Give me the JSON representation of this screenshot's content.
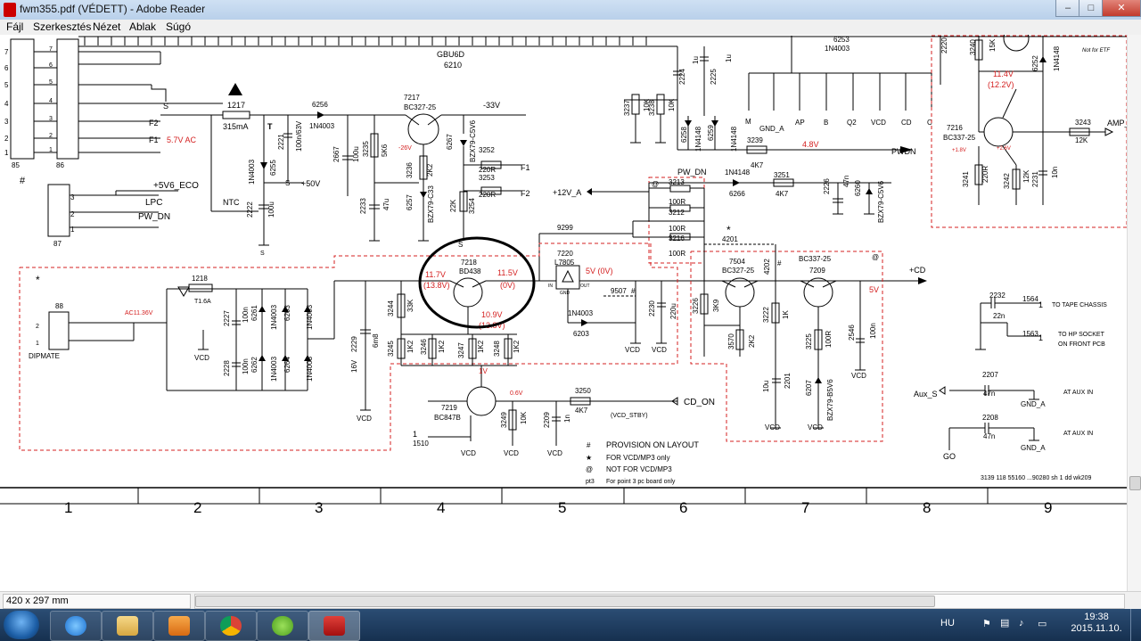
{
  "window": {
    "title": "fwm355.pdf (VÉDETT) - Adobe Reader",
    "buttons": {
      "minimize": "–",
      "maximize": "□",
      "close": "✕"
    }
  },
  "menu": [
    "Fájl",
    "Szerkesztés",
    "Nézet",
    "Ablak",
    "Súgó"
  ],
  "status": {
    "page_size": "420 x 297 mm"
  },
  "taskbar": {
    "apps": [
      "internet-explorer-icon",
      "file-explorer-icon",
      "media-player-icon",
      "chrome-icon",
      "utorrent-icon",
      "adobe-reader-icon"
    ],
    "language": "HU",
    "time": "19:38",
    "date": "2015.11.10."
  },
  "colors": {
    "titlebar": "#bcd2ec",
    "schematic_ink": "#000000",
    "annotation_red": "#d42020",
    "taskbar": "#1f3d62"
  },
  "schematic": {
    "connector_left": {
      "pins": [
        "7",
        "6",
        "5",
        "4",
        "3",
        "2",
        "1"
      ],
      "left_label": "85",
      "right_label": "86"
    },
    "connector_87": {
      "pins": [
        "3",
        "2",
        "1"
      ],
      "label": "87",
      "signals": [
        "LPC",
        "PW_DN"
      ]
    },
    "connector_88": {
      "pins": [
        "2",
        "1"
      ],
      "label": "88",
      "name": "DIPMATE"
    },
    "bus": {
      "name": "GBU6D",
      "ref": "6210"
    },
    "top_left": {
      "f2": "F2",
      "f1": "F1",
      "f1_ac": "5.7V AC",
      "s_mark": "S",
      "plus5v6eco": "+5V6_ECO",
      "hash": "#"
    },
    "fuse": {
      "ref": "1217",
      "value": "315mA",
      "t": "T"
    },
    "ntc": "NTC",
    "c2222": {
      "ref": "2222",
      "value": "100u"
    },
    "d6255": {
      "ref": "6255",
      "part": "1N4003"
    },
    "c2221": {
      "ref": "2221",
      "value": "100n/63V",
      "s": "S",
      "plus50v": "+50V"
    },
    "d6256": {
      "ref": "6256",
      "part": "1N4003"
    },
    "c2667": {
      "ref": "2667",
      "value": "100u"
    },
    "r3235": {
      "ref": "3235",
      "value": "5K6"
    },
    "c2233": {
      "ref": "2233",
      "value": "47u"
    },
    "t7217": {
      "ref": "7217",
      "part": "BC327-25",
      "neg33": "-33V",
      "neg26": "-26V"
    },
    "r3236": {
      "ref": "3236",
      "value": "2K2"
    },
    "z6257": {
      "ref": "6257",
      "part": "BZX79-C33"
    },
    "z6267": {
      "ref": "6267",
      "part": "BZX79-C5V6"
    },
    "r3252": {
      "ref": "3252",
      "value": "220R",
      "net": "F1"
    },
    "r3253": {
      "ref": "3253",
      "value": "220R",
      "net": "F2"
    },
    "r3254": {
      "ref": "3254",
      "value": "22K",
      "s": "S"
    },
    "plus12v": "+12V_A",
    "r3237": {
      "ref": "3237",
      "value": "10K"
    },
    "r3238": {
      "ref": "3238",
      "value": "10K"
    },
    "c2224": {
      "ref": "2224",
      "value": "1u"
    },
    "c2225": {
      "ref": "2225",
      "value": "1u"
    },
    "d6258": {
      "ref": "6258",
      "part": "1N4148"
    },
    "d6259": {
      "ref": "6259",
      "part": "1N4148"
    },
    "d6253": {
      "ref": "6253",
      "part": "1N4003"
    },
    "pins_row": [
      "M",
      "GND_A",
      "AP",
      "B",
      "Q2",
      "VCD",
      "CD",
      "C"
    ],
    "r3239": {
      "ref": "3239",
      "value": "4K7"
    },
    "v48": "4.8V",
    "pwdn": "PWDN",
    "pw_dn": "PW_DN",
    "d6266": {
      "ref": "6266",
      "part": "1N4148"
    },
    "r3251": {
      "ref": "3251",
      "value": "4K7"
    },
    "c2226": {
      "ref": "2226",
      "value": "47n"
    },
    "z6260": {
      "ref": "6260",
      "part": "BZX79-C5V6"
    },
    "r3213": {
      "ref": "3213",
      "value": "100R"
    },
    "r3212": {
      "ref": "3212",
      "value": "100R"
    },
    "r3216": {
      "ref": "3216",
      "value": "100R"
    },
    "at": "@",
    "star": "*",
    "net9299": "9299",
    "r4201": "4201",
    "r4202": "4202",
    "reg7220": {
      "ref": "7220",
      "part": "L7805",
      "in": "IN",
      "gnd": "GND",
      "out": "OUT",
      "v5": "5V (0V)"
    },
    "d6203": {
      "ref": "6203",
      "part": "1N4003"
    },
    "net9507": "9507",
    "c2230": {
      "ref": "2230",
      "value": "220u"
    },
    "t7218": {
      "ref": "7218",
      "part": "BD438",
      "v_left": "11.7V",
      "v_left2": "(13.8V)",
      "v_right": "11.5V",
      "v_right2": "(0V)",
      "v_bottom": "10.9V",
      "v_bottom2": "(13.8V)"
    },
    "transformer_1218": {
      "ref": "1218",
      "value": "T1.6A",
      "ac": "AC11.36V"
    },
    "c2227": {
      "ref": "2227",
      "value": "100n"
    },
    "c2228": {
      "ref": "2228",
      "value": "100n"
    },
    "d6261": "6261",
    "d6262": "6262",
    "d6263": "6263",
    "d6264": "6264",
    "d1n4003": "1N4003",
    "c2229": {
      "ref": "2229",
      "value": "6m8",
      "v16": "16V"
    },
    "r3244": {
      "ref": "3244",
      "value": "33K"
    },
    "r3245": {
      "ref": "3245",
      "value": "1K2"
    },
    "r3246": {
      "ref": "3246",
      "value": "1K2"
    },
    "r3247": {
      "ref": "3247",
      "value": "1K2"
    },
    "r3248": {
      "ref": "3248",
      "value": "1K2"
    },
    "v1": "1V",
    "t7219": {
      "ref": "7219",
      "part": "BC847B",
      "v06": "0.6V"
    },
    "r3249": {
      "ref": "3249",
      "value": "10K"
    },
    "c2209": {
      "ref": "2209",
      "value": "1n"
    },
    "r3250": {
      "ref": "3250",
      "value": "4K7"
    },
    "cd_on": "CD_ON",
    "vcd_stby": "(VCD_STBY)",
    "pin1510": {
      "ref": "1510",
      "pin": "1"
    },
    "vcd": "VCD",
    "t7504": {
      "ref": "7504",
      "part": "BC327-25"
    },
    "t7209": {
      "ref": "7209",
      "part": "BC337-25"
    },
    "r3226": {
      "ref": "3226",
      "value": "3K9"
    },
    "r3570": {
      "ref": "3570",
      "value": "2K2"
    },
    "r3222": {
      "ref": "3222",
      "value": "1K"
    },
    "r3225": {
      "ref": "3225",
      "value": "100R"
    },
    "c2546": {
      "ref": "2546",
      "value": "100n"
    },
    "c2201": {
      "ref": "2201",
      "value": "10u"
    },
    "z6207": {
      "ref": "6207",
      "part": "BZX79-B5V6"
    },
    "plus_cd": "+CD",
    "v5": "5V",
    "r3240": {
      "ref": "3240",
      "value": "15K"
    },
    "d6252": {
      "ref": "6252",
      "part": "1N4148"
    },
    "r2220": "2220",
    "not_for_etf": "Not for ETF",
    "v114": "11.4V",
    "v122": "(12.2V)",
    "t7216": {
      "ref": "7216",
      "part": "BC337-25",
      "v18": "+1.8V",
      "v26": "+2.6V"
    },
    "r3243": {
      "ref": "3243",
      "value": "12K"
    },
    "amp_on": "AMP_ON",
    "r3241": {
      "ref": "3241",
      "value": "220R"
    },
    "r3242": {
      "ref": "3242",
      "value": "12K"
    },
    "c2231": {
      "ref": "2231",
      "value": "10n"
    },
    "c2232": {
      "ref": "2232",
      "value": "22n"
    },
    "pin1564": {
      "ref": "1564",
      "pin": "1",
      "label": "TO TAPE CHASSIS"
    },
    "pin1563": {
      "ref": "1563",
      "pin": "1",
      "label": "TO HP SOCKET",
      "label2": "ON FRONT PCB"
    },
    "c2207": {
      "ref": "2207",
      "value": "47n",
      "net": "Aux_S",
      "gnd": "GND_A",
      "note": "AT AUX IN"
    },
    "c2208": {
      "ref": "2208",
      "value": "47n",
      "net": "GO",
      "gnd": "GND_A",
      "note": "AT AUX IN"
    },
    "legend": {
      "hash": {
        "sym": "#",
        "text": "PROVISION ON LAYOUT"
      },
      "star": {
        "sym": "★",
        "text": "FOR VCD/MP3 only"
      },
      "at": {
        "sym": "@",
        "text": "NOT FOR VCD/MP3"
      },
      "pt3": {
        "sym": "pt3",
        "text": "For point 3 pc board only"
      }
    },
    "doc_code": "3139 118 55160 ...90280 sh 1 dd wk209",
    "grid_numbers": [
      "1",
      "2",
      "3",
      "4",
      "5",
      "6",
      "7",
      "8",
      "9"
    ]
  }
}
